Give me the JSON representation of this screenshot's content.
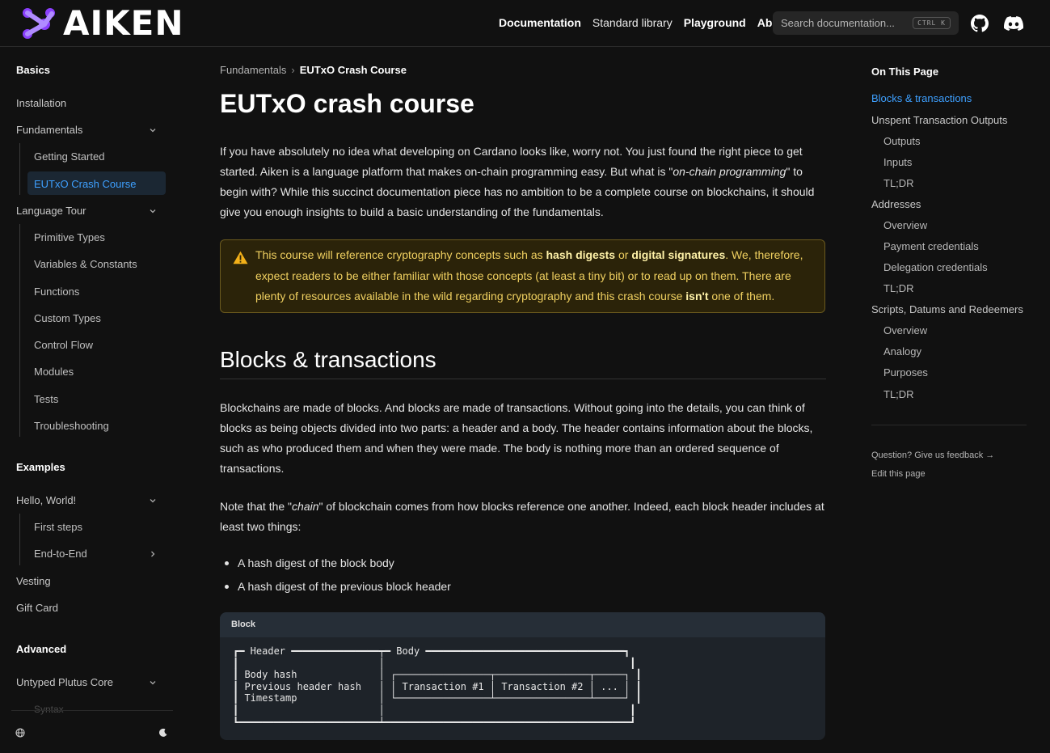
{
  "header": {
    "logo_text": "AIKEN",
    "nav": [
      {
        "label": "Documentation",
        "bold": true
      },
      {
        "label": "Standard library",
        "bold": false
      },
      {
        "label": "Playground",
        "bold": true
      },
      {
        "label": "About",
        "bold": true
      }
    ],
    "search_placeholder": "Search documentation...",
    "search_shortcut": "CTRL K",
    "icons": [
      "github-icon",
      "discord-icon"
    ]
  },
  "sidebar": {
    "sections": {
      "basics": "Basics",
      "examples": "Examples",
      "advanced": "Advanced"
    },
    "basics_items": {
      "installation": "Installation",
      "fundamentals": "Fundamentals",
      "getting_started": "Getting Started",
      "eutxo": "EUTxO Crash Course",
      "language_tour": "Language Tour",
      "primitive_types": "Primitive Types",
      "variables": "Variables & Constants",
      "functions": "Functions",
      "custom_types": "Custom Types",
      "control_flow": "Control Flow",
      "modules": "Modules",
      "tests": "Tests",
      "troubleshooting": "Troubleshooting"
    },
    "examples_items": {
      "hello_world": "Hello, World!",
      "first_steps": "First steps",
      "end_to_end": "End-to-End",
      "vesting": "Vesting",
      "gift_card": "Gift Card"
    },
    "advanced_items": {
      "untyped_plutus_core": "Untyped Plutus Core",
      "syntax_faded": "Syntax"
    },
    "active_item": "EUTxO Crash Course",
    "bottom_icons": [
      "globe-icon",
      "moon-icon"
    ]
  },
  "main": {
    "breadcrumb": {
      "parent": "Fundamentals",
      "current": "EUTxO Crash Course"
    },
    "title": "EUTxO crash course",
    "intro": {
      "before": "If you have absolutely no idea what developing on Cardano looks like, worry not. You just found the right piece to get started. Aiken is a language platform that makes on-chain programming easy. But what is \"",
      "em": "on-chain programming",
      "after": "\" to begin with? While this succinct documentation piece has no ambition to be a complete course on blockchains, it should give you enough insights to build a basic understanding of the fundamentals."
    },
    "warning": {
      "t1": "This course will reference cryptography concepts such as ",
      "b1": "hash digests",
      "t2": " or ",
      "b2": "digital signatures",
      "t3": ". We, therefore, expect readers to be either familiar with those concepts (at least a tiny bit) or to read up on them. There are plenty of resources available in the wild regarding cryptography and this crash course ",
      "b3": "isn't",
      "t4": " one of them."
    },
    "section_title": "Blocks & transactions",
    "para1": "Blockchains are made of blocks. And blocks are made of transactions. Without going into the details, you can think of blocks as being objects divided into two parts: a header and a body. The header contains information about the blocks, such as who produced them and when they were made. The body is nothing more than an ordered sequence of transactions.",
    "para2": {
      "before": "Note that the \"",
      "em": "chain",
      "after": "\" of blockchain comes from how blocks reference one another. Indeed, each block header includes at least two things:"
    },
    "bullets": [
      "A hash digest of the block body",
      "A hash digest of the previous block header"
    ],
    "code": {
      "title": "Block",
      "body": "┏━ Header ━━━━━━━━━━━━━━━┯━ Body ━━━━━━━━━━━━━━━━━━━━━━━━━━━━━━━━━━┓\n┃                        │                                          ┃\n┃ Body hash              │ ┌────────────────┬────────────────┬─────┐ ┃\n┃ Previous header hash   │ │ Transaction #1 │ Transaction #2 │ ... │ ┃\n┃ Timestamp              │ └────────────────┴────────────────┴─────┘ ┃\n┃                        │                                          ┃\n┗━━━━━━━━━━━━━━━━━━━━━━━━┷━━━━━━━━━━━━━━━━━━━━━━━━━━━━━━━━━━━━━━━━━━┛"
    }
  },
  "toc": {
    "title": "On This Page",
    "items": [
      {
        "label": "Blocks & transactions",
        "level": 1,
        "active": true
      },
      {
        "label": "Unspent Transaction Outputs",
        "level": 1
      },
      {
        "label": "Outputs",
        "level": 2
      },
      {
        "label": "Inputs",
        "level": 2
      },
      {
        "label": "TL;DR",
        "level": 2
      },
      {
        "label": "Addresses",
        "level": 1
      },
      {
        "label": "Overview",
        "level": 2
      },
      {
        "label": "Payment credentials",
        "level": 2
      },
      {
        "label": "Delegation credentials",
        "level": 2
      },
      {
        "label": "TL;DR",
        "level": 2
      },
      {
        "label": "Scripts, Datums and Redeemers",
        "level": 1
      },
      {
        "label": "Overview",
        "level": 2
      },
      {
        "label": "Analogy",
        "level": 2
      },
      {
        "label": "Purposes",
        "level": 2
      },
      {
        "label": "TL;DR",
        "level": 2
      }
    ],
    "feedback": "Question? Give us feedback →",
    "edit": "Edit this page"
  },
  "colors": {
    "background": "#111111",
    "accent": "#3ea0ff",
    "warning_text": "#f0d060",
    "logo_purple": "#8a3ffc"
  }
}
